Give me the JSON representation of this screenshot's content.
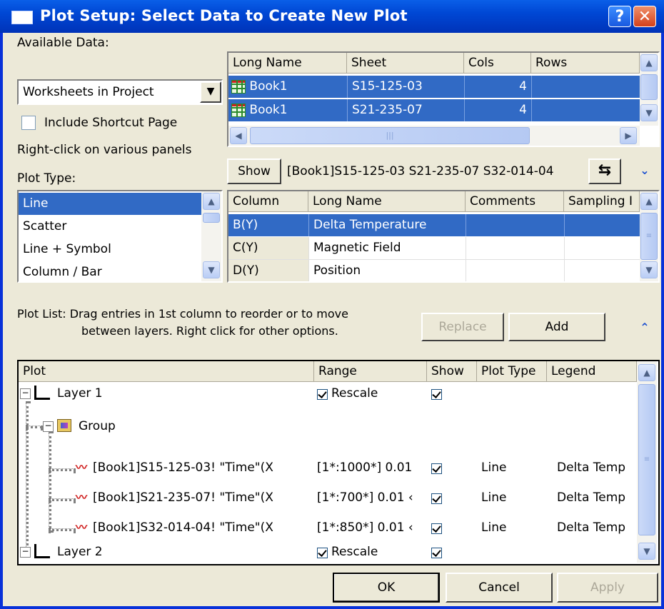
{
  "window": {
    "title": "Plot Setup: Select Data to Create New Plot",
    "help_glyph": "?",
    "close_glyph": "✕"
  },
  "available": {
    "label": "Available Data:",
    "dropdown_value": "Worksheets in Project",
    "include_shortcut_label": "Include Shortcut Page",
    "include_shortcut_checked": false,
    "hint": "Right-click on various panels"
  },
  "sheets": {
    "headers": [
      "Long Name",
      "Sheet",
      "Cols",
      "Rows"
    ],
    "rows": [
      {
        "long_name": "Book1",
        "sheet": "S15-125-03",
        "cols": "4",
        "rows": ""
      },
      {
        "long_name": "Book1",
        "sheet": "S21-235-07",
        "cols": "4",
        "rows": ""
      }
    ],
    "hscroll_grip": "|||"
  },
  "show_bar": {
    "button": "Show",
    "path": "[Book1]S15-125-03 S21-235-07 S32-014-04"
  },
  "plot_type": {
    "label": "Plot Type:",
    "items": [
      "Line",
      "Scatter",
      "Line + Symbol",
      "Column / Bar"
    ],
    "selected": "Line"
  },
  "columns": {
    "headers": [
      "Column",
      "Long Name",
      "Comments",
      "Sampling I"
    ],
    "rows": [
      {
        "column": "B(Y)",
        "long_name": "Delta Temperature"
      },
      {
        "column": "C(Y)",
        "long_name": "Magnetic Field"
      },
      {
        "column": "D(Y)",
        "long_name": "Position"
      }
    ]
  },
  "plot_list": {
    "instructions_line1": "Plot List: Drag entries in 1st column to reorder or to move",
    "instructions_line2": "between layers. Right click for other options.",
    "replace_label": "Replace",
    "add_label": "Add",
    "headers": [
      "Plot",
      "Range",
      "Show",
      "Plot Type",
      "Legend"
    ],
    "layer1": {
      "name": "Layer 1",
      "range": "Rescale"
    },
    "group": {
      "name": "Group"
    },
    "plots": [
      {
        "name": "[Book1]S15-125-03! \"Time\"(X",
        "range": "[1*:1000*]  0.01",
        "type": "Line",
        "legend": "Delta Temp"
      },
      {
        "name": "[Book1]S21-235-07! \"Time\"(X",
        "range": "[1*:700*]  0.01 ‹",
        "type": "Line",
        "legend": "Delta Temp"
      },
      {
        "name": "[Book1]S32-014-04! \"Time\"(X",
        "range": "[1*:850*]  0.01 ‹",
        "type": "Line",
        "legend": "Delta Temp"
      }
    ],
    "layer2": {
      "name": "Layer 2",
      "range": "Rescale"
    },
    "tree_minus": "−"
  },
  "footer": {
    "ok": "OK",
    "cancel": "Cancel",
    "apply": "Apply"
  },
  "colors": {
    "title_bar": "#0047d4",
    "selection": "#316ac5",
    "face": "#ece9d8"
  }
}
